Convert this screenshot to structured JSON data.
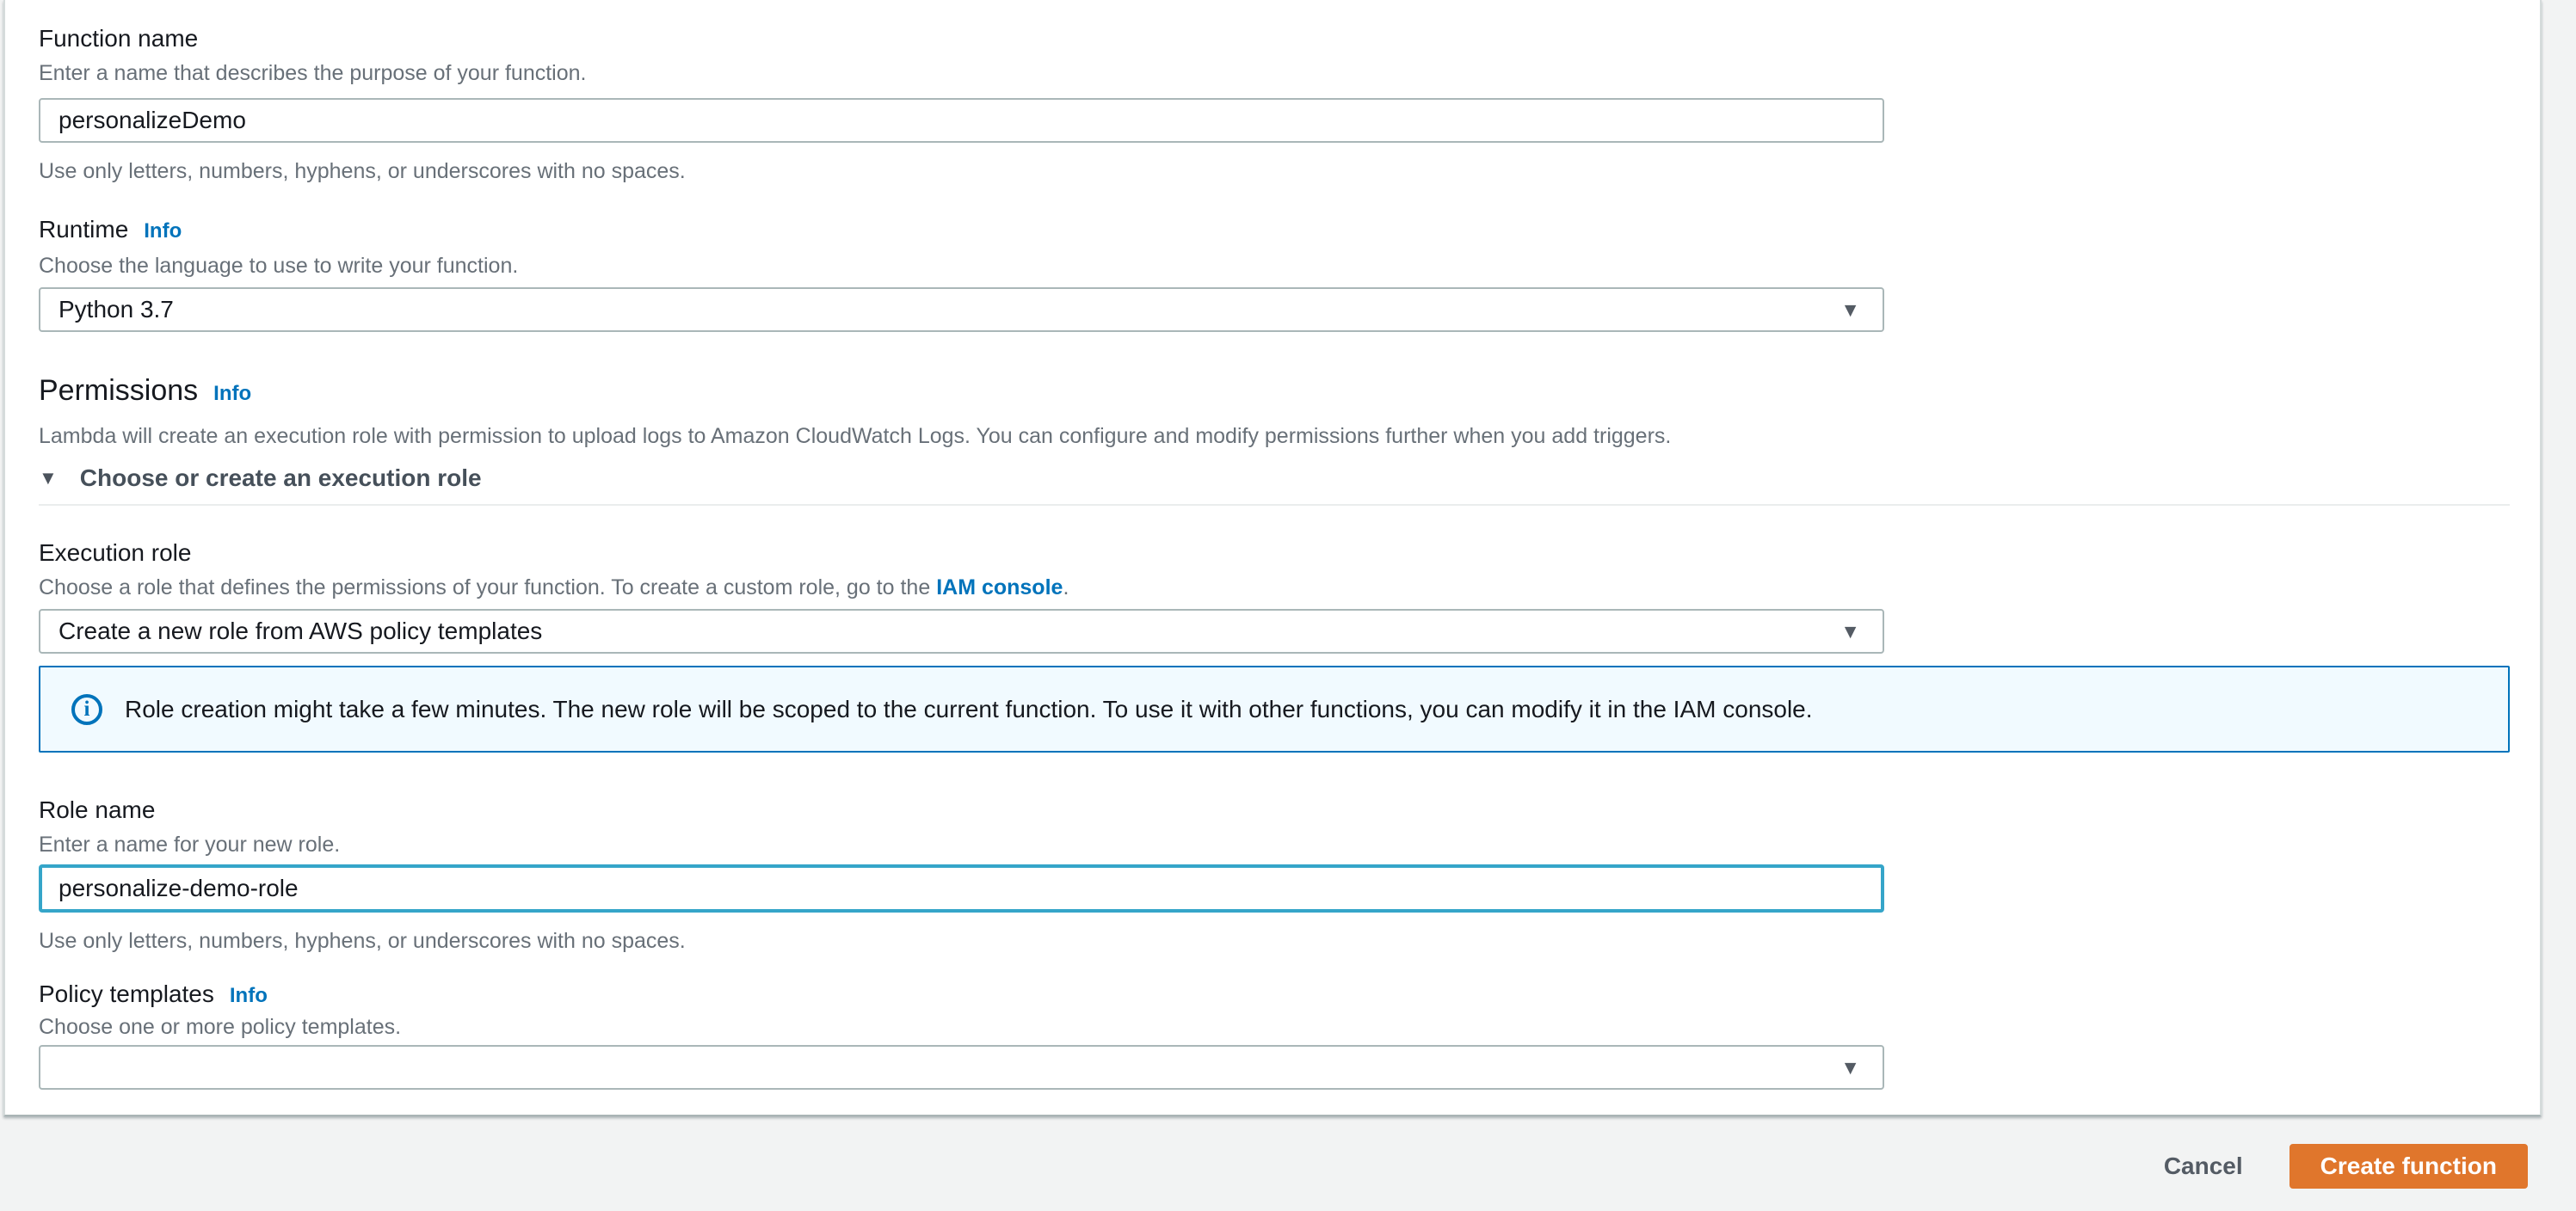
{
  "colors": {
    "page_background": "#f2f3f3",
    "card_background": "#ffffff",
    "accent_link_blue": "#0073bb",
    "focus_border_blue": "#35a5c9",
    "alert_background": "#f1faff",
    "alert_border": "#0073bb",
    "primary_button_orange": "#e0762c",
    "label_text": "#16191f",
    "secondary_text": "#687078"
  },
  "icons": {
    "dropdown_arrow": "▼",
    "collapse_arrow": "▼",
    "info_symbol": "i"
  },
  "form": {
    "function_name": {
      "label": "Function name",
      "description": "Enter a name that describes the purpose of your function.",
      "value": "personalizeDemo",
      "helper": "Use only letters, numbers, hyphens, or underscores with no spaces."
    },
    "runtime": {
      "label": "Runtime",
      "info_label": "Info",
      "description": "Choose the language to use to write your function.",
      "value": "Python 3.7"
    },
    "permissions": {
      "heading": "Permissions",
      "info_label": "Info",
      "description": "Lambda will create an execution role with permission to upload logs to Amazon CloudWatch Logs. You can configure and modify permissions further when you add triggers.",
      "collapsible_label": "Choose or create an execution role"
    },
    "execution_role": {
      "label": "Execution role",
      "description_prefix": "Choose a role that defines the permissions of your function. To create a custom role, go to the ",
      "link_text": "IAM console",
      "description_suffix": ".",
      "value": "Create a new role from AWS policy templates"
    },
    "role_alert": {
      "text": "Role creation might take a few minutes. The new role will be scoped to the current function. To use it with other functions, you can modify it in the IAM console."
    },
    "role_name": {
      "label": "Role name",
      "description": "Enter a name for your new role.",
      "value": "personalize-demo-role",
      "helper": "Use only letters, numbers, hyphens, or underscores with no spaces."
    },
    "policy_templates": {
      "label": "Policy templates",
      "info_label": "Info",
      "description": "Choose one or more policy templates.",
      "value": ""
    }
  },
  "footer": {
    "cancel_label": "Cancel",
    "create_label": "Create function"
  }
}
